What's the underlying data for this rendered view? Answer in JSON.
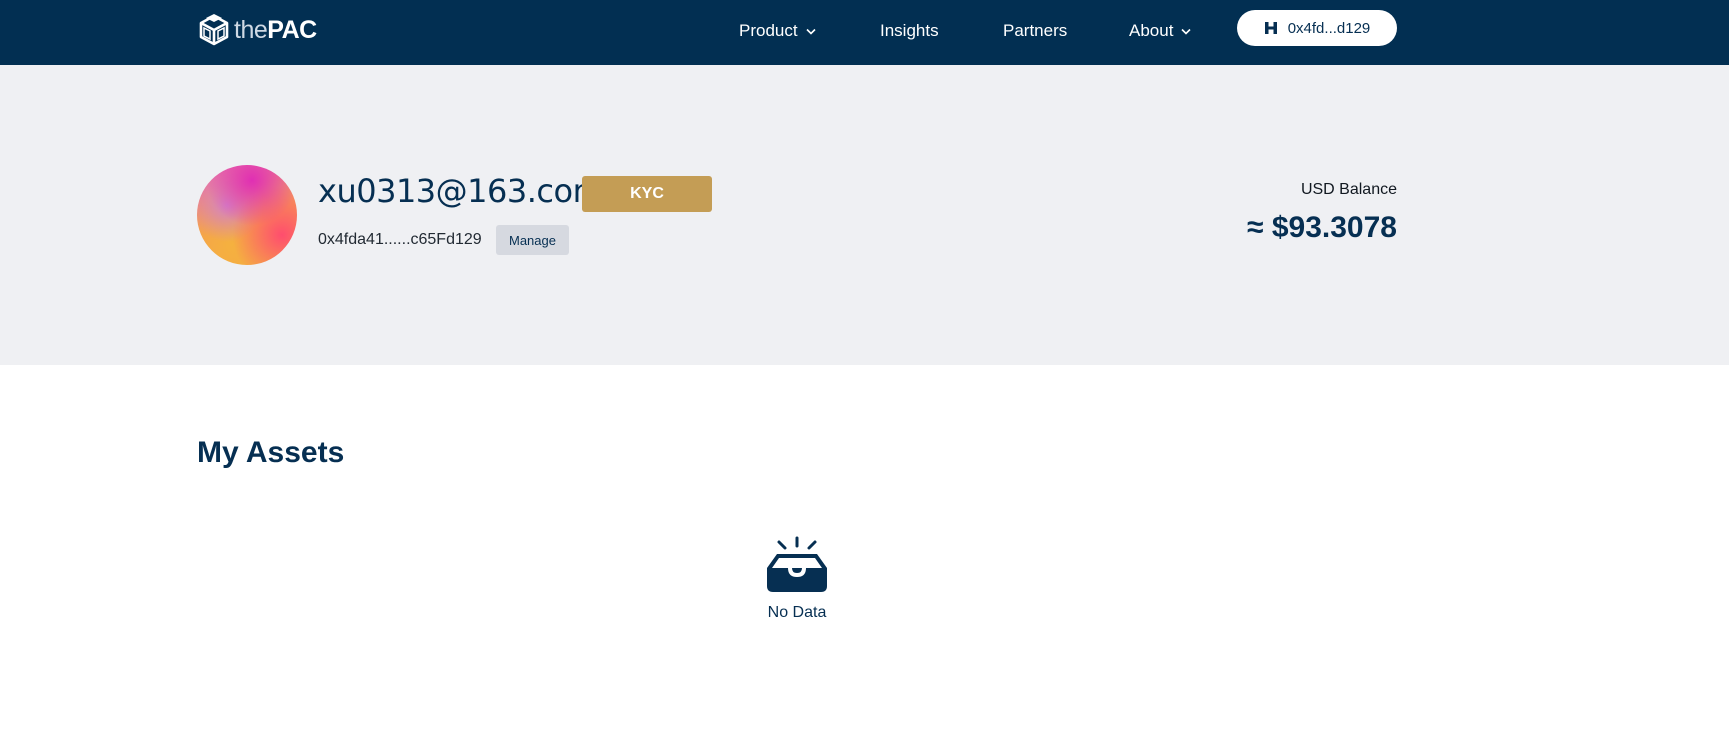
{
  "brand": {
    "name_light": "the",
    "name_bold": "PAC",
    "logo_icon": "cube-logo-icon"
  },
  "nav": {
    "items": [
      {
        "label": "Product",
        "has_dropdown": true
      },
      {
        "label": "Insights",
        "has_dropdown": false
      },
      {
        "label": "Partners",
        "has_dropdown": false
      },
      {
        "label": "About",
        "has_dropdown": true
      }
    ],
    "wallet": {
      "label": "0x4fd...d129",
      "icon": "wallet-h-icon"
    }
  },
  "profile": {
    "email": "xu0313@163.com",
    "kyc_label": "KYC",
    "address": "0x4fda41......c65Fd129",
    "manage_label": "Manage",
    "balance_label": "USD Balance",
    "balance_value": "≈ $93.3078"
  },
  "assets": {
    "title": "My Assets",
    "empty_text": "No Data",
    "empty_icon": "inbox-icon"
  },
  "colors": {
    "navy": "#022f52",
    "band": "#eff0f3",
    "gold": "#c49d55",
    "manage_bg": "#d6d9e0"
  }
}
